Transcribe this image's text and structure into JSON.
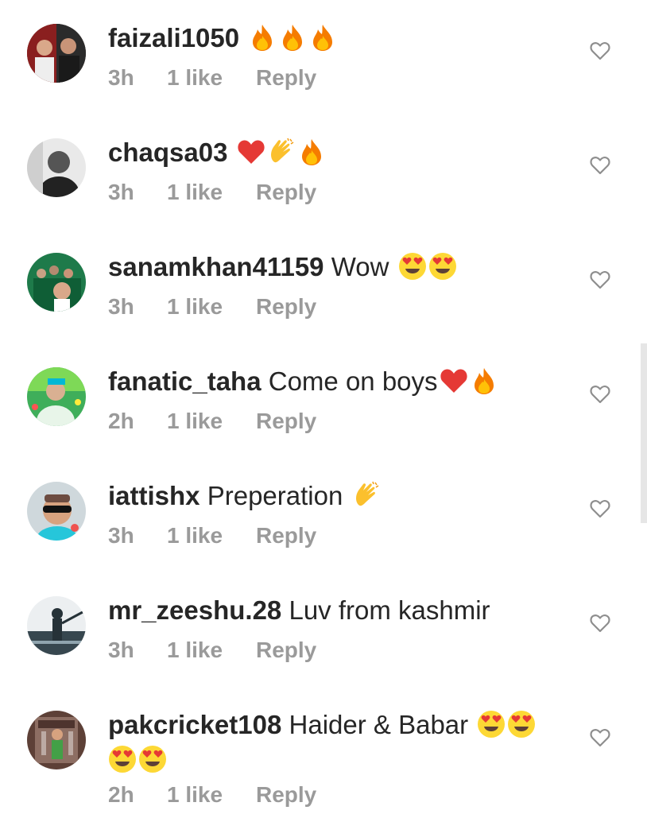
{
  "comments": [
    {
      "username": "faizali1050",
      "text": "",
      "emojis": [
        "fire",
        "fire",
        "fire"
      ],
      "time": "3h",
      "likes": "1 like",
      "reply": "Reply"
    },
    {
      "username": "chaqsa03",
      "text": "",
      "emojis": [
        "red-heart",
        "clapping-hands",
        "fire"
      ],
      "time": "3h",
      "likes": "1 like",
      "reply": "Reply"
    },
    {
      "username": "sanamkhan41159",
      "text": "Wow",
      "emojis": [
        "heart-eyes",
        "heart-eyes"
      ],
      "time": "3h",
      "likes": "1 like",
      "reply": "Reply"
    },
    {
      "username": "fanatic_taha",
      "text": "Come on boys",
      "emojis": [
        "red-heart",
        "fire"
      ],
      "time": "2h",
      "likes": "1 like",
      "reply": "Reply"
    },
    {
      "username": "iattishx",
      "text": "Preperation",
      "emojis": [
        "clapping-hands"
      ],
      "time": "3h",
      "likes": "1 like",
      "reply": "Reply"
    },
    {
      "username": "mr_zeeshu.28",
      "text": "Luv from kashmir",
      "emojis": [],
      "time": "3h",
      "likes": "1 like",
      "reply": "Reply"
    },
    {
      "username": "pakcricket108",
      "text": "Haider & Babar",
      "emojis": [
        "heart-eyes",
        "heart-eyes",
        "heart-eyes",
        "heart-eyes"
      ],
      "time": "2h",
      "likes": "1 like",
      "reply": "Reply"
    }
  ],
  "colors": {
    "text": "#262626",
    "meta": "#9a9a9a",
    "heart_outline": "#8e8e8e"
  }
}
